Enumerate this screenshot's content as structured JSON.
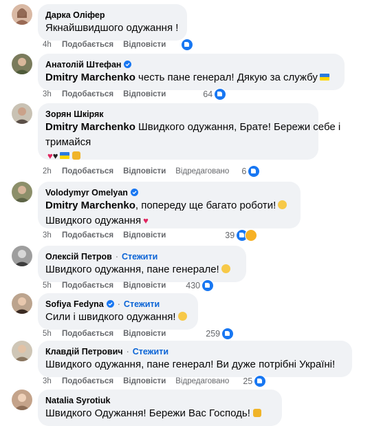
{
  "comments": [
    {
      "author": "Дарка Оліфер",
      "text": "Якнайшвидшого одужання !",
      "time": "4h",
      "like": "Подобається",
      "reply": "Відповісти"
    },
    {
      "author": "Анатолій Штефан",
      "mention": "Dmitry Marchenko",
      "text": " честь пане генерал! Дякую за службу",
      "time": "3h",
      "like": "Подобається",
      "reply": "Відповісти",
      "reactions": "64"
    },
    {
      "author": "Зорян Шкіряк",
      "mention": "Dmitry Marchenko",
      "text": " Швидкого одужання, Брате! Бережи себе і",
      "text2": "тримайся",
      "time": "2h",
      "like": "Подобається",
      "reply": "Відповісти",
      "edited": "Відредаговано",
      "reactions": "6"
    },
    {
      "author": "Volodymyr Omelyan",
      "mention": "Dmitry Marchenko",
      "text": ", попереду ще багато роботи!",
      "text2": "Швидкого одужання",
      "time": "3h",
      "like": "Подобається",
      "reply": "Відповісти",
      "reactions": "39"
    },
    {
      "author": "Олексій Петров",
      "follow": "Стежити",
      "text": "Швидкого одужання, пане генерале!",
      "time": "5h",
      "like": "Подобається",
      "reply": "Відповісти",
      "reactions": "430"
    },
    {
      "author": "Sofiya Fedyna",
      "follow": "Стежити",
      "text": "Сили і швидкого одужання!",
      "time": "5h",
      "like": "Подобається",
      "reply": "Відповісти",
      "reactions": "259"
    },
    {
      "author": "Клавдій Петрович",
      "follow": "Стежити",
      "text": "Швидкого одужання, пане генерал! Ви дуже потрібні Україні!",
      "time": "3h",
      "like": "Подобається",
      "reply": "Відповісти",
      "edited": "Відредаговано",
      "reactions": "25"
    },
    {
      "author": "Natalia Syrotiuk",
      "text": "Швидкого Одужання! Бережи Вас Господь!"
    }
  ],
  "colors": {
    "bubble": "#f0f2f5",
    "link": "#0a64d6",
    "meta": "#65676b",
    "like": "#1877f2"
  }
}
